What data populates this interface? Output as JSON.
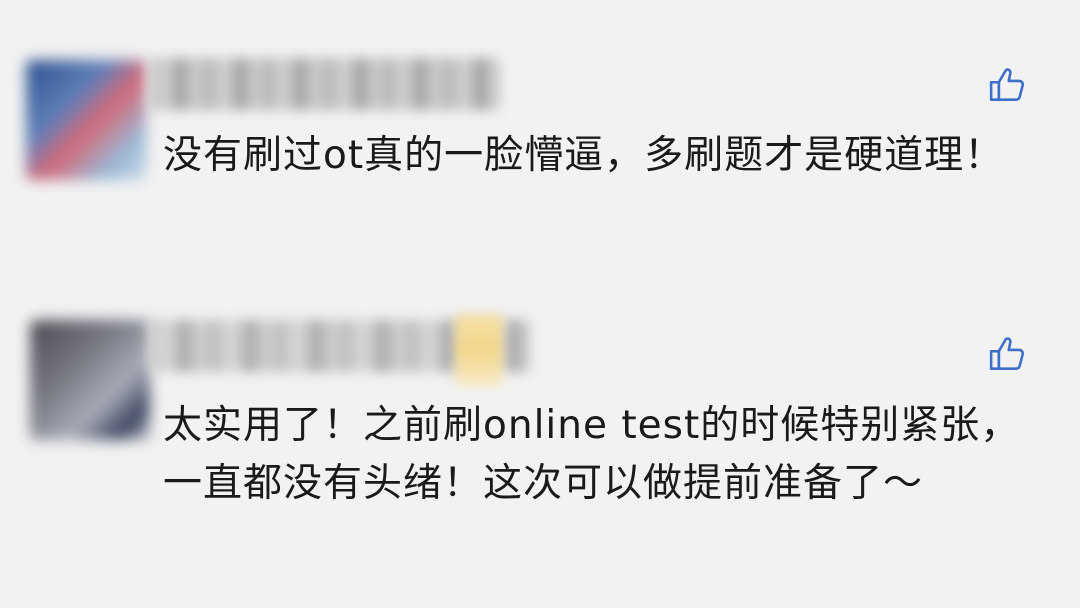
{
  "comments": [
    {
      "author_name": "",
      "text": "没有刷过ot真的一脸懵逼，多刷题才是硬道理！",
      "like_icon": "thumbs-up-icon"
    },
    {
      "author_name": "",
      "text": "太实用了！之前刷online test的时候特别紧张，一直都没有头绪！这次可以做提前准备了～",
      "like_icon": "thumbs-up-icon"
    }
  ],
  "colors": {
    "background": "#f2f2f2",
    "text": "#1a1a1a",
    "like_icon": "#3d6ec9"
  }
}
